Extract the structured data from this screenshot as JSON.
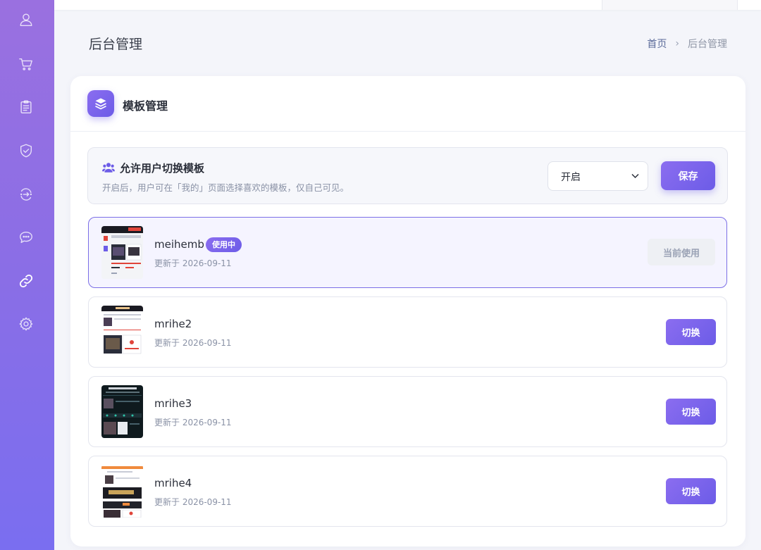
{
  "sidebar": {
    "items": [
      {
        "icon": "user-icon"
      },
      {
        "icon": "cart-icon"
      },
      {
        "icon": "clipboard-icon"
      },
      {
        "icon": "shield-check-icon"
      },
      {
        "icon": "exchange-icon"
      },
      {
        "icon": "chat-icon"
      },
      {
        "icon": "link-icon",
        "active": true
      },
      {
        "icon": "gear-icon"
      }
    ]
  },
  "header": {
    "page_title": "后台管理",
    "breadcrumb": {
      "home": "首页",
      "separator": "›",
      "current": "后台管理"
    }
  },
  "card": {
    "title": "模板管理",
    "icon": "layers-icon",
    "switch_setting": {
      "label": "允许用户切换模板",
      "description": "开启后，用户可在「我的」页面选择喜欢的模板，仅自己可见。",
      "select_value": "开启",
      "save_label": "保存"
    },
    "templates": [
      {
        "name": "meihemb",
        "badge": "使用中",
        "updated": "更新于 2026-09-11",
        "action": "当前使用",
        "active": true
      },
      {
        "name": "mrihe2",
        "updated": "更新于 2026-09-11",
        "action": "切换"
      },
      {
        "name": "mrihe3",
        "updated": "更新于 2026-09-11",
        "action": "切换"
      },
      {
        "name": "mrihe4",
        "updated": "更新于 2026-09-11",
        "action": "切换"
      }
    ]
  },
  "colors": {
    "accent": "#6c5ce7",
    "sidebar_top": "#9a70e0",
    "sidebar_bottom": "#7a6ef0",
    "background": "#f4f5fa"
  }
}
